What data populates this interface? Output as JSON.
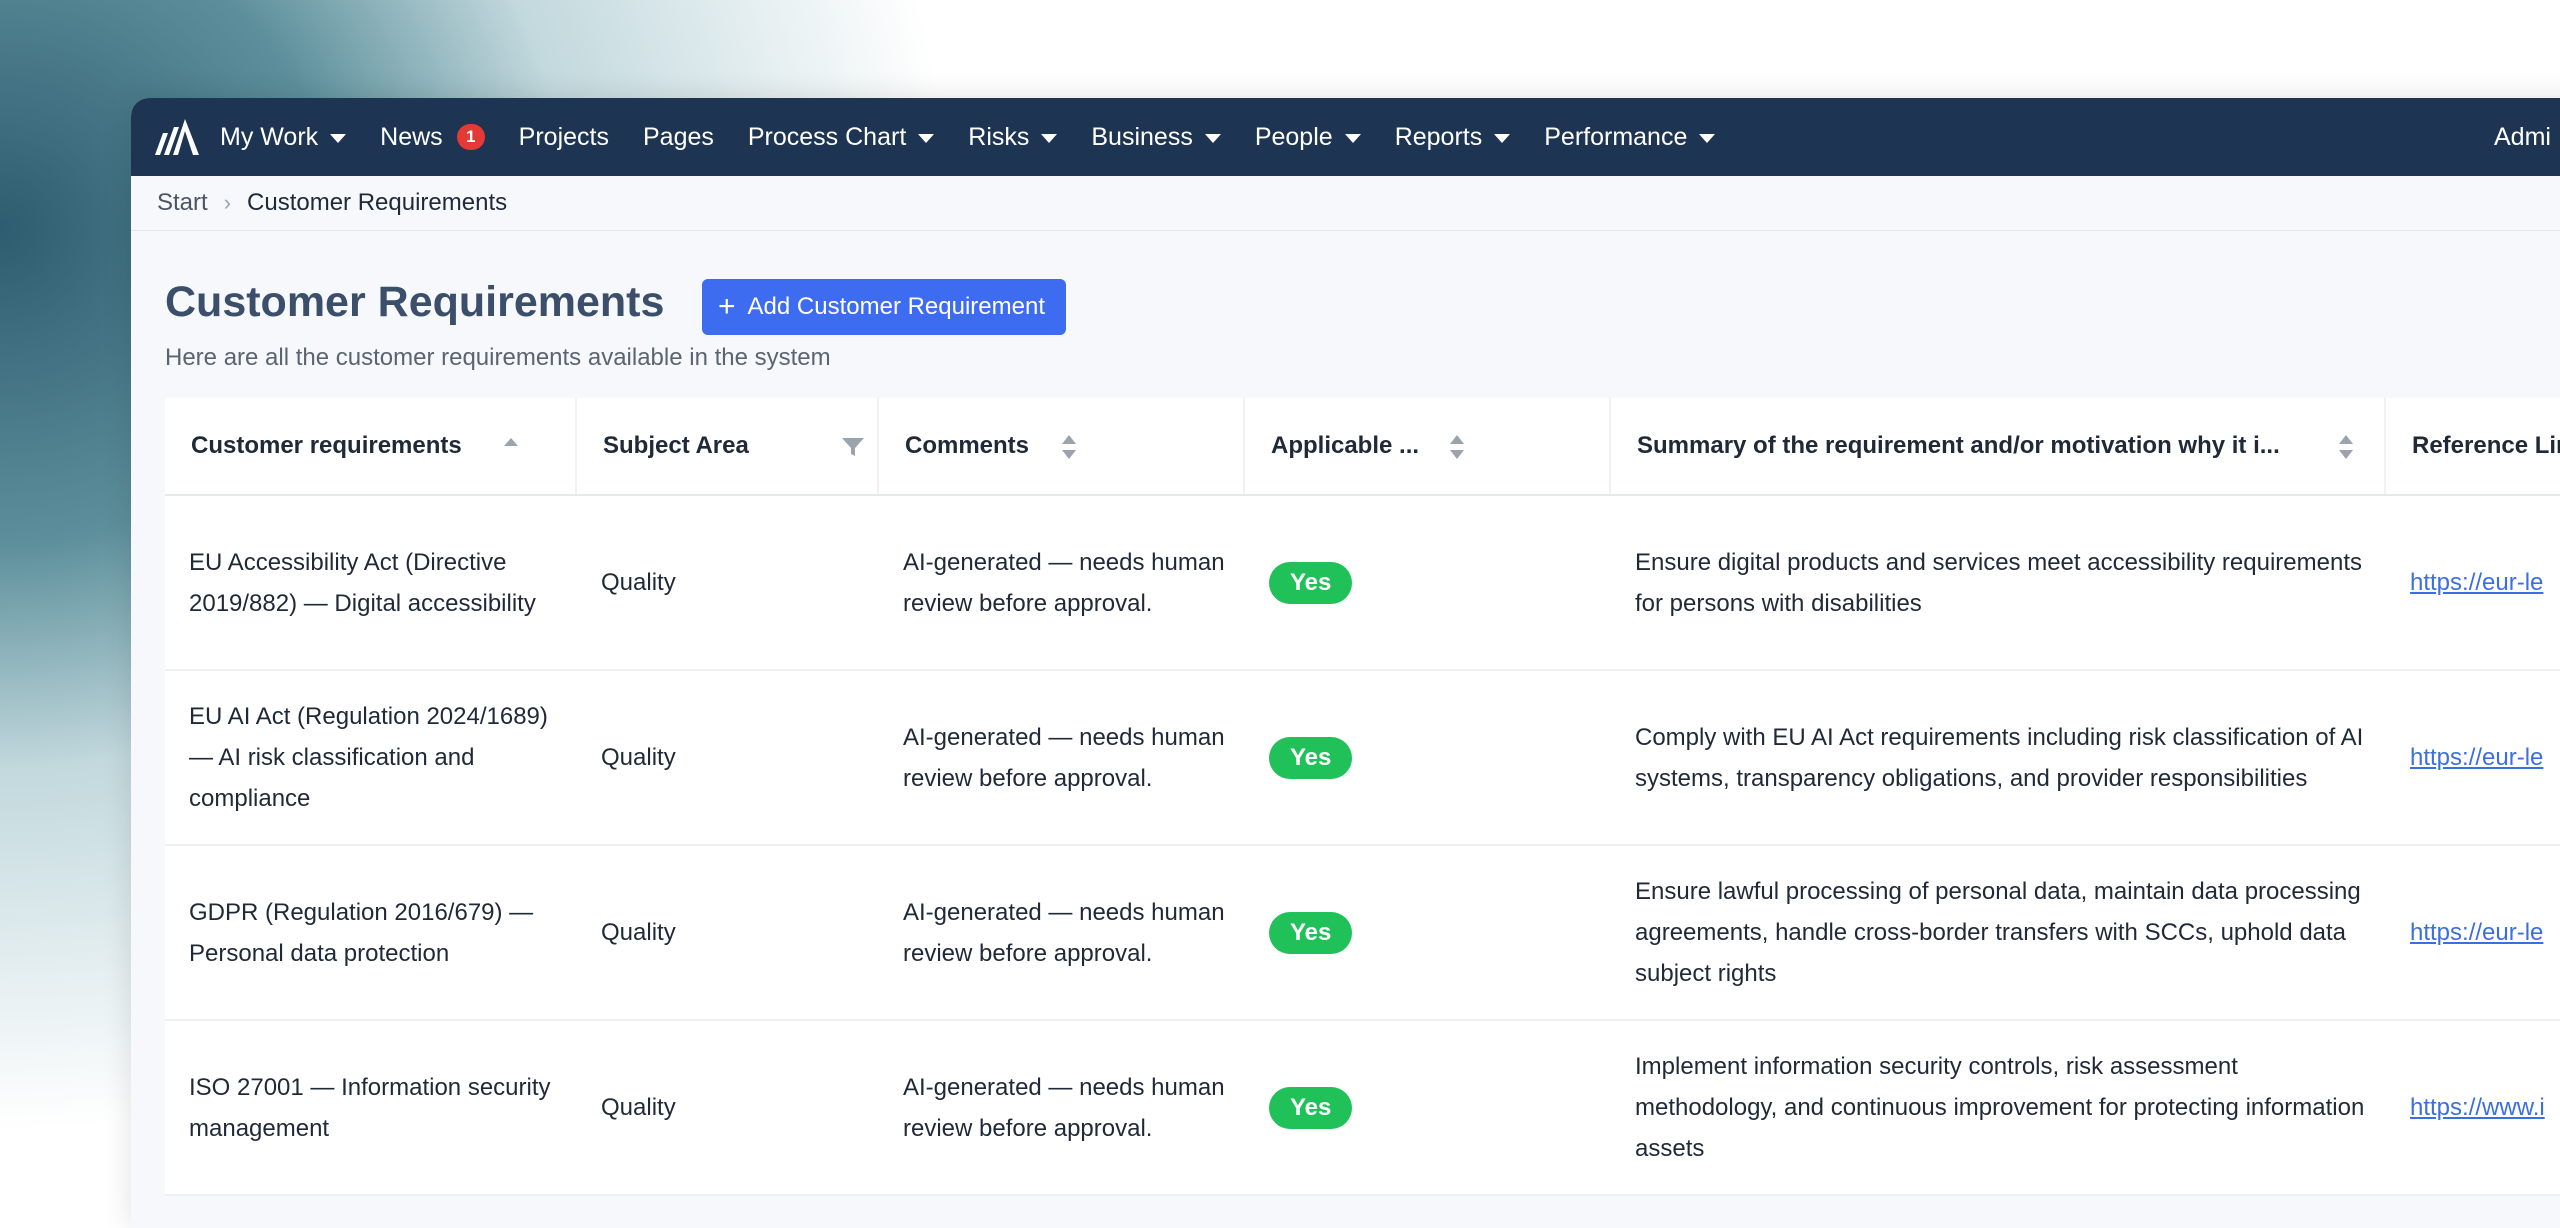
{
  "nav": {
    "logo_icon": "stacked-bars-logo-icon",
    "items": [
      {
        "label": "My Work",
        "dropdown": true
      },
      {
        "label": "News",
        "badge": "1"
      },
      {
        "label": "Projects"
      },
      {
        "label": "Pages"
      },
      {
        "label": "Process Chart",
        "dropdown": true
      },
      {
        "label": "Risks",
        "dropdown": true
      },
      {
        "label": "Business",
        "dropdown": true
      },
      {
        "label": "People",
        "dropdown": true
      },
      {
        "label": "Reports",
        "dropdown": true
      },
      {
        "label": "Performance",
        "dropdown": true
      }
    ],
    "right_label": "Admi"
  },
  "breadcrumb": {
    "start": "Start",
    "current": "Customer Requirements"
  },
  "page": {
    "title": "Customer Requirements",
    "add_button_label": "Add Customer Requirement",
    "subtitle": "Here are all the customer requirements available in the system"
  },
  "table": {
    "columns": [
      {
        "label": "Customer requirements",
        "icon": "sort-ascending-icon"
      },
      {
        "label": "Subject Area",
        "icon": "filter-icon"
      },
      {
        "label": "Comments",
        "icon": "sort-icon"
      },
      {
        "label": "Applicable ...",
        "icon": "sort-icon"
      },
      {
        "label": "Summary of the requirement and/or motivation why it i...",
        "icon": "sort-icon"
      },
      {
        "label": "Reference Lin"
      }
    ],
    "rows": [
      {
        "requirement": "EU Accessibility Act (Directive 2019/882) — Digital accessibility",
        "subject_area": "Quality",
        "comments": "AI-generated — needs human review before approval.",
        "applicable": "Yes",
        "summary": "Ensure digital products and services meet accessibility requirements for persons with disabilities",
        "reference": "https://eur-le"
      },
      {
        "requirement": "EU AI Act (Regulation 2024/1689) — AI risk classification and compliance",
        "subject_area": "Quality",
        "comments": "AI-generated — needs human review before approval.",
        "applicable": "Yes",
        "summary": "Comply with EU AI Act requirements including risk classification of AI systems, transparency obligations, and provider responsibilities",
        "reference": "https://eur-le"
      },
      {
        "requirement": "GDPR (Regulation 2016/679) — Personal data protection",
        "subject_area": "Quality",
        "comments": "AI-generated — needs human review before approval.",
        "applicable": "Yes",
        "summary": "Ensure lawful processing of personal data, maintain data processing agreements, handle cross-border transfers with SCCs, uphold data subject rights",
        "reference": "https://eur-le"
      },
      {
        "requirement": "ISO 27001 — Information security management",
        "subject_area": "Quality",
        "comments": "AI-generated — needs human review before approval.",
        "applicable": "Yes",
        "summary": "Implement information security controls, risk assessment methodology, and continuous improvement for protecting information assets",
        "reference": "https://www.i"
      }
    ]
  },
  "colors": {
    "nav_bg": "#1d3552",
    "accent": "#3d6cf0",
    "yes_badge": "#21c15a",
    "news_badge": "#e53935",
    "title": "#3b4f6b",
    "link": "#3b6fe0"
  }
}
